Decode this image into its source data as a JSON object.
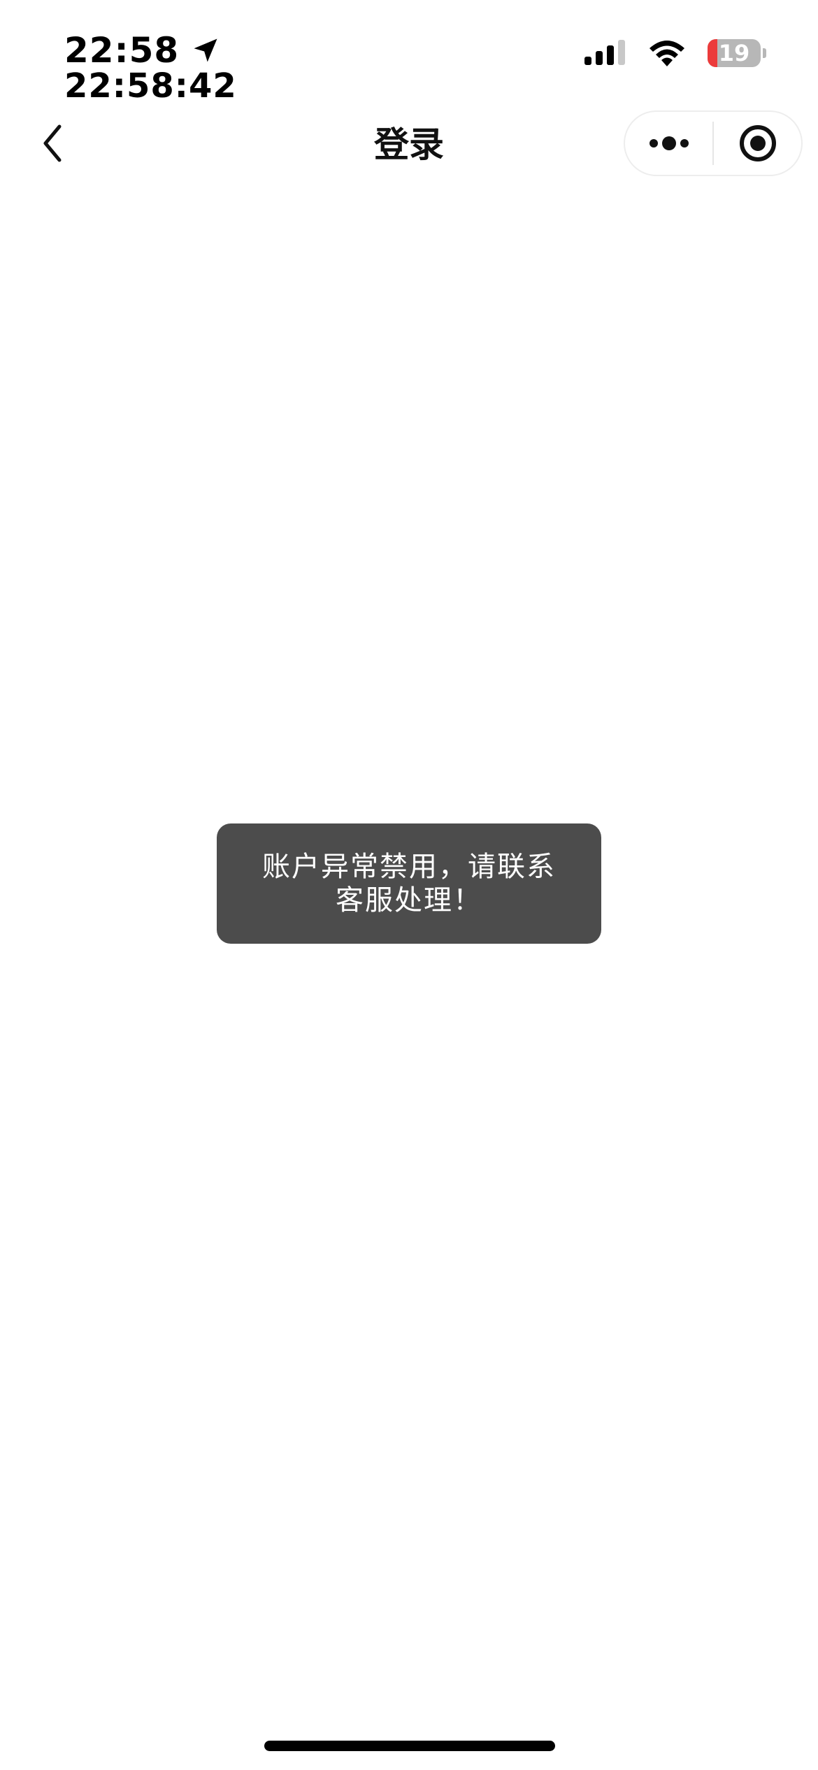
{
  "status_bar": {
    "time": "22:58",
    "clock": "22:58:42",
    "battery_level": "19",
    "battery_fraction": 0.19,
    "location_icon": "location-arrow-icon",
    "signal_icon": "cellular-signal-icon",
    "wifi_icon": "wifi-icon"
  },
  "nav": {
    "title": "登录",
    "back_icon": "chevron-left-icon",
    "more_icon": "more-dots-icon",
    "close_icon": "target-circle-icon"
  },
  "toast": {
    "line1": "账户异常禁用，请联系",
    "line2": "客服处理！"
  },
  "colors": {
    "toast_bg": "#4c4c4c",
    "battery_low": "#ec3b3b",
    "battery_bg": "#b7b7b7"
  }
}
